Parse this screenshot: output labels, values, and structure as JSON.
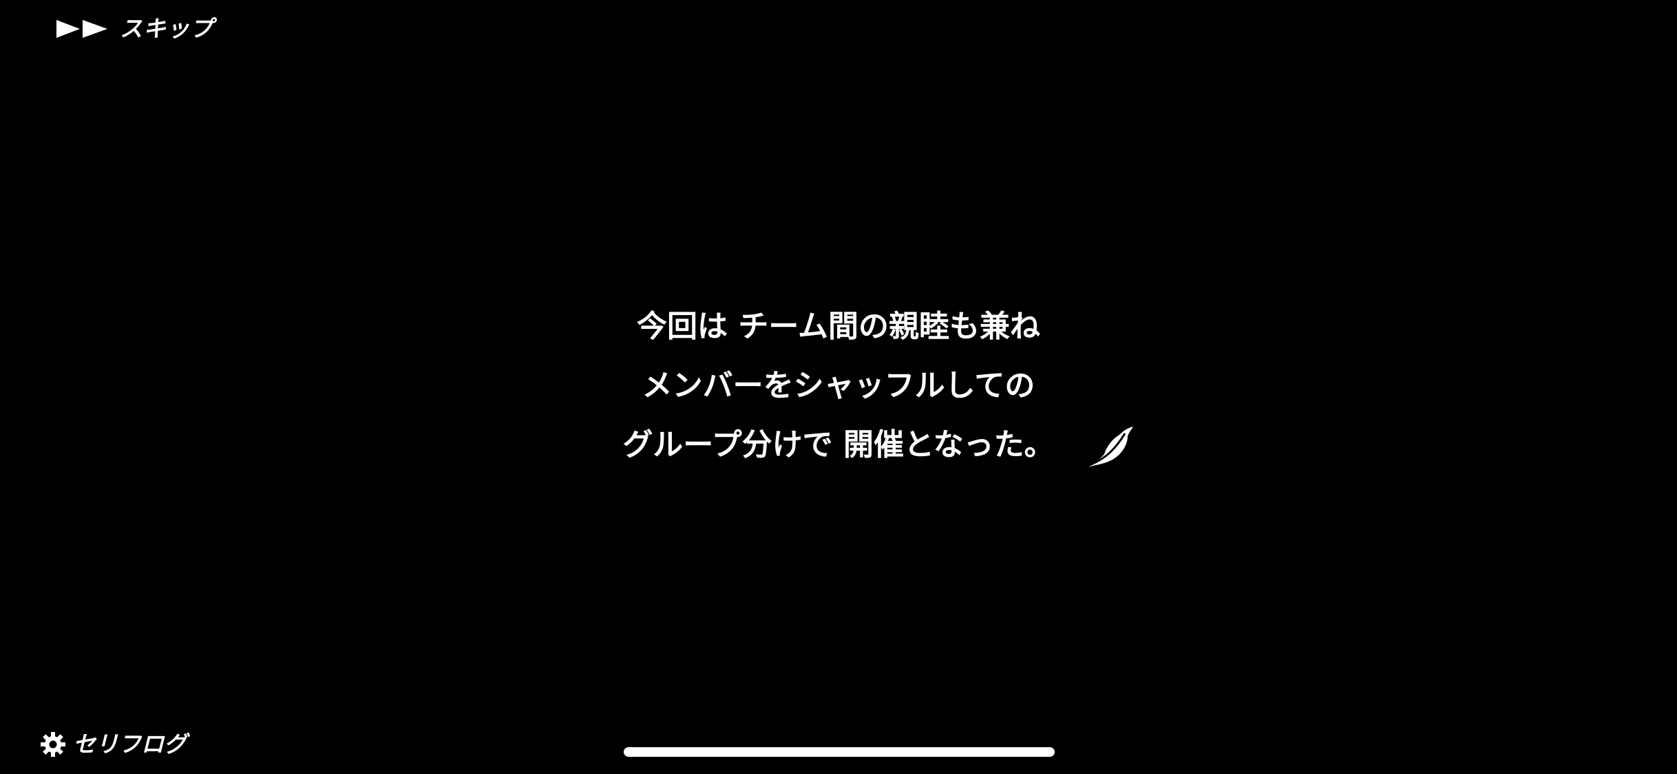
{
  "header": {
    "skip_icon": "fast-forward-icon",
    "skip_label": "スキップ"
  },
  "dialogue": {
    "lines": [
      "今回は チーム間の親睦も兼ね",
      "メンバーをシャッフルしての",
      "グループ分けで 開催となった。"
    ],
    "continue_icon": "quill-feather-icon"
  },
  "footer": {
    "log_icon": "gear-icon",
    "log_label": "セリフログ"
  },
  "colors": {
    "background": "#000000",
    "text": "#ffffff"
  }
}
